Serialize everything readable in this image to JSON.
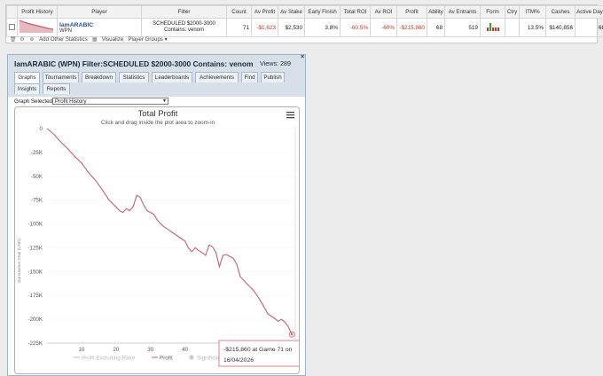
{
  "table": {
    "headers": [
      "Profit History",
      "Player",
      "Filter",
      "Count",
      "Av Profit",
      "Av Stake",
      "Early Finish",
      "Total ROI",
      "Av ROI",
      "Profit",
      "Ability",
      "Av Entrants",
      "Form",
      "Ctry",
      "ITM%",
      "Cashes",
      "Active Days"
    ],
    "row": {
      "player": "IamARABIC",
      "network": "WPN",
      "filter_line1": "SCHEDULED $2000-3000",
      "filter_line2": "Contains: venom",
      "count": "71",
      "av_profit": "-$1,623",
      "av_stake": "$2,530",
      "early_finish": "3.8%",
      "total_roi": "-60.5%",
      "av_roi": "-60%",
      "profit": "-$215,860",
      "ability": "68",
      "av_entrants": "519",
      "ctry": "",
      "itm": "13.5%",
      "cashes": "$140,856",
      "active_days": "68"
    },
    "toolbar": {
      "add_stats": "Add Other Statistics",
      "visualize": "Visualize",
      "player_groups": "Player Groups ▾"
    }
  },
  "panel": {
    "title": "IamARABIC (WPN) Filter:SCHEDULED $2000-3000 Contains: venom",
    "views": "Views: 289",
    "close": "×",
    "tabs": [
      "Graphs",
      "Tournaments",
      "Breakdown",
      "Statistics",
      "Leaderboards",
      "Achievements",
      "Find",
      "Publish",
      "Insights",
      "Reports"
    ],
    "graph_selected_label": "Graph Selected:",
    "graph_selected_value": "Profit History"
  },
  "colors": {
    "line": "#c2646f",
    "accent": "#1f4f9f",
    "negative": "#c0392b"
  },
  "chart_data": {
    "type": "line",
    "title": "Total Profit",
    "subtitle": "Click and drag inside the plot area to zoom-in",
    "ylabel": "Cumulative Total (USD)",
    "xlim": [
      0,
      72
    ],
    "ylim": [
      -225000,
      0
    ],
    "yticks": [
      0,
      -25000,
      -50000,
      -75000,
      -100000,
      -125000,
      -150000,
      -175000,
      -200000,
      -225000
    ],
    "ytick_labels": [
      "0",
      "-25K",
      "-50K",
      "-75K",
      "-100K",
      "-125K",
      "-150K",
      "-175K",
      "-200K",
      "-225K"
    ],
    "xticks": [
      10,
      20,
      30,
      40
    ],
    "xtick_labels": [
      "10",
      "20",
      "30",
      "40"
    ],
    "legend": [
      "Profit Excluding Rake",
      "Profit",
      "Significance"
    ],
    "tooltip": {
      "line1": "-$215,860 at Game 71 on",
      "line2": "16/04/2026"
    },
    "series": [
      {
        "name": "Profit",
        "x": [
          0,
          2,
          4,
          6,
          8,
          10,
          12,
          14,
          16,
          18,
          20,
          21,
          22,
          23,
          24,
          25,
          26,
          27,
          28,
          29,
          30,
          31,
          32,
          33,
          34,
          36,
          38,
          40,
          41,
          42,
          43,
          44,
          45,
          46,
          47,
          48,
          49,
          50,
          51,
          52,
          53,
          54,
          55,
          56,
          58,
          60,
          62,
          64,
          66,
          67,
          68,
          69,
          70,
          71
        ],
        "y": [
          0,
          -6000,
          -14000,
          -21000,
          -29000,
          -36000,
          -46000,
          -54000,
          -64000,
          -75000,
          -82000,
          -86000,
          -88000,
          -84000,
          -86000,
          -82000,
          -70000,
          -72000,
          -80000,
          -86000,
          -88000,
          -90000,
          -96000,
          -100000,
          -103000,
          -108000,
          -113000,
          -118000,
          -125000,
          -129000,
          -125000,
          -128000,
          -130000,
          -133000,
          -122000,
          -124000,
          -130000,
          -145000,
          -133000,
          -132000,
          -134000,
          -136000,
          -142000,
          -155000,
          -163000,
          -170000,
          -181000,
          -194000,
          -199000,
          -202000,
          -200000,
          -203000,
          -208000,
          -215860
        ]
      }
    ]
  }
}
